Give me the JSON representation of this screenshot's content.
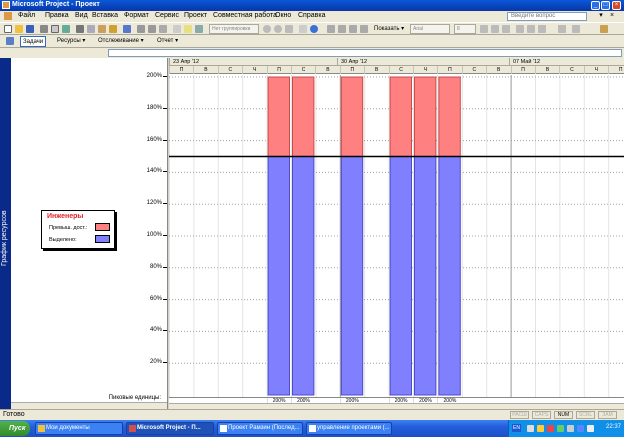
{
  "window": {
    "title": "Microsoft Project - Проект",
    "controls": [
      "_",
      "□",
      "×"
    ]
  },
  "menu": {
    "items": [
      "Файл",
      "Правка",
      "Вид",
      "Вставка",
      "Формат",
      "Сервис",
      "Проект",
      "Совместная работа",
      "Окно",
      "Справка"
    ],
    "ask_placeholder": "Введите вопрос",
    "mdi_controls": [
      "▾",
      "×"
    ]
  },
  "toolbar1": {
    "group_combo": "Нет группировки",
    "show_label": "Показать ▾",
    "font_combo": "Arial",
    "size_combo": "8",
    "icons": [
      "new-icon",
      "open-icon",
      "save-icon",
      "print-icon",
      "preview-icon",
      "spell-icon",
      "cut-icon",
      "copy-icon",
      "paste-icon",
      "format-painter-icon",
      "undo-icon",
      "link-icon",
      "unlink-icon",
      "split-icon",
      "task-info-icon",
      "notes-icon",
      "assign-icon",
      "zoom-in-icon",
      "zoom-out-icon",
      "goto-icon",
      "copy-picture-icon",
      "help-icon",
      "arrow-left-icon",
      "arrow-right-icon",
      "arrow-up-icon",
      "arrow-down-icon",
      "bold-icon",
      "italic-icon",
      "underline-icon",
      "align-left-icon",
      "align-center-icon",
      "align-right-icon",
      "filter-icon",
      "wizard-icon"
    ]
  },
  "toolbar2": {
    "items": [
      {
        "label": "Задачи",
        "active": true
      },
      {
        "label": "Ресурсы ▾",
        "active": false
      },
      {
        "label": "Отслеживание ▾",
        "active": false
      },
      {
        "label": "Отчет ▾",
        "active": false
      }
    ]
  },
  "view_bar": {
    "label": "График ресурсов"
  },
  "legend": {
    "title": "Инженеры",
    "rows": [
      {
        "label": "Превыш. дост.:",
        "color": "#ff8080"
      },
      {
        "label": "Выделено:",
        "color": "#8080ff"
      }
    ]
  },
  "peak_units_label": "Пиковые единицы:",
  "timescale": {
    "weeks": [
      "23 Апр '12",
      "30 Апр '12",
      "07 Май '12"
    ],
    "days": [
      "П",
      "В",
      "С",
      "Ч",
      "П",
      "С",
      "В",
      "П",
      "В",
      "С",
      "Ч",
      "П",
      "С",
      "В",
      "П",
      "В",
      "С",
      "Ч",
      "П"
    ]
  },
  "chart_data": {
    "type": "bar",
    "ylabel": "",
    "ylim": [
      0,
      200
    ],
    "y_ticks": [
      "200%",
      "180%",
      "160%",
      "140%",
      "120%",
      "100%",
      "80%",
      "60%",
      "40%",
      "20%"
    ],
    "max_available": 150,
    "categories": [
      "П",
      "В",
      "С",
      "Ч",
      "П",
      "С",
      "В",
      "П",
      "В",
      "С",
      "Ч",
      "П",
      "С",
      "В",
      "П",
      "В",
      "С",
      "Ч",
      "П"
    ],
    "series": [
      {
        "name": "Выделено",
        "color": "#8080ff",
        "values": [
          0,
          0,
          0,
          0,
          150,
          150,
          0,
          150,
          0,
          150,
          150,
          150,
          0,
          0,
          0,
          0,
          0,
          0,
          0
        ]
      },
      {
        "name": "Превыш. дост.",
        "color": "#ff8080",
        "values": [
          0,
          0,
          0,
          0,
          50,
          50,
          0,
          50,
          0,
          50,
          50,
          50,
          0,
          0,
          0,
          0,
          0,
          0,
          0
        ]
      }
    ],
    "peak_units": [
      "",
      "",
      "",
      "",
      "200%",
      "200%",
      "",
      "200%",
      "",
      "200%",
      "200%",
      "200%",
      "",
      "",
      "",
      "",
      "",
      "",
      ""
    ]
  },
  "status": {
    "text": "Готово",
    "indicators": [
      {
        "label": "РАСШ",
        "on": false
      },
      {
        "label": "CAPS",
        "on": false
      },
      {
        "label": "NUM",
        "on": true
      },
      {
        "label": "SCRL",
        "on": false
      },
      {
        "label": "ЗАМ",
        "on": false
      }
    ]
  },
  "taskbar": {
    "start": "Пуск",
    "buttons": [
      {
        "label": "Мои документы",
        "active": false,
        "color": "#f0c040"
      },
      {
        "label": "Microsoft Project - П...",
        "active": true,
        "color": "#d05050"
      },
      {
        "label": "Проект Рамзин (Послед...",
        "active": false,
        "color": "#2b5fc8"
      },
      {
        "label": "управление проектами (...",
        "active": false,
        "color": "#2b5fc8"
      }
    ],
    "lang": "EN",
    "clock": "22:37"
  }
}
